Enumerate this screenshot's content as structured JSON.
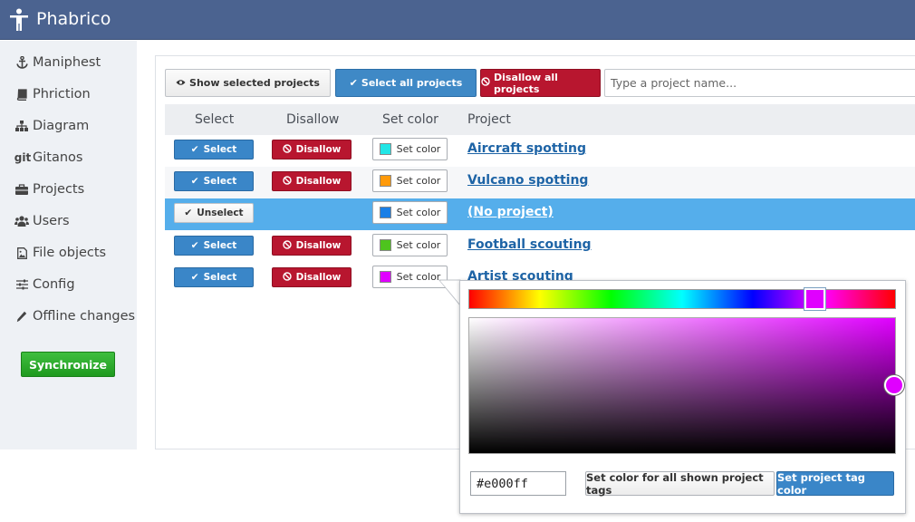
{
  "app": {
    "title": "Phabrico"
  },
  "sidebar": {
    "items": [
      {
        "label": "Maniphest",
        "icon": "anchor-icon"
      },
      {
        "label": "Phriction",
        "icon": "book-icon"
      },
      {
        "label": "Diagram",
        "icon": "sitemap-icon"
      },
      {
        "label": "Gitanos",
        "icon": "git-icon"
      },
      {
        "label": "Projects",
        "icon": "briefcase-icon"
      },
      {
        "label": "Users",
        "icon": "users-icon"
      },
      {
        "label": "File objects",
        "icon": "file-image-icon"
      },
      {
        "label": "Config",
        "icon": "sliders-icon"
      },
      {
        "label": "Offline changes",
        "icon": "pencil-icon"
      }
    ],
    "synchronize_label": "Synchronize"
  },
  "toolbar": {
    "show_selected_label": "Show selected projects",
    "select_all_label": "Select all projects",
    "disallow_all_label": "Disallow all projects",
    "search_placeholder": "Type a project name..."
  },
  "table": {
    "headers": [
      "Select",
      "Disallow",
      "Set color",
      "Project"
    ],
    "rows": [
      {
        "select_label": "Select",
        "disallow_label": "Disallow",
        "color_label": "Set color",
        "color": "#22e6e6",
        "project": "Aircraft spotting",
        "selected": false
      },
      {
        "select_label": "Select",
        "disallow_label": "Disallow",
        "color_label": "Set color",
        "color": "#ff9a0a",
        "project": "Vulcano spotting",
        "selected": false
      },
      {
        "select_label": "Unselect",
        "disallow_label": "",
        "color_label": "Set color",
        "color": "#1a7fe6",
        "project": "(No project)",
        "selected": true
      },
      {
        "select_label": "Select",
        "disallow_label": "Disallow",
        "color_label": "Set color",
        "color": "#4ec41e",
        "project": "Football scouting",
        "selected": false
      },
      {
        "select_label": "Select",
        "disallow_label": "Disallow",
        "color_label": "Set color",
        "color": "#e000ff",
        "project": "Artist scouting",
        "selected": false
      }
    ]
  },
  "picker": {
    "hex_value": "#e000ff",
    "current_color": "#e000ff",
    "set_all_label": "Set color for all shown project tags",
    "set_tag_label": "Set project tag color"
  },
  "colors": {
    "header_bg": "#4b6390",
    "accent_blue": "#3a86c8",
    "danger_red": "#b8162f",
    "success_green": "#1f9a1f",
    "selected_row": "#55aeeb"
  }
}
